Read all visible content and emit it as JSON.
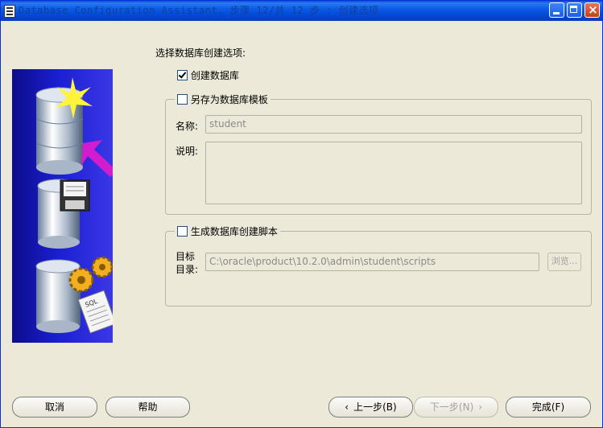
{
  "window": {
    "title": "Database Configuration Assistant, 步骤 12/共 12 步 : 创建选项",
    "colors": {
      "titlebar": "#0a4fd6",
      "client_bg": "#ece9d8",
      "close_btn": "#c73f1c"
    }
  },
  "main": {
    "section_title": "选择数据库创建选项:",
    "create_db": {
      "label": "创建数据库",
      "checked": true
    },
    "save_template": {
      "legend": "另存为数据库模板",
      "checked": false,
      "name_label": "名称:",
      "name_value": "student",
      "desc_label": "说明:",
      "desc_value": ""
    },
    "gen_scripts": {
      "legend": "生成数据库创建脚本",
      "checked": false,
      "dest_label_line1": "目标",
      "dest_label_line2": "目录:",
      "dest_value": "C:\\oracle\\product\\10.2.0\\admin\\student\\scripts",
      "browse_label": "浏览..."
    }
  },
  "footer": {
    "cancel": "取消",
    "help": "帮助",
    "back": "上一步(B)",
    "next": "下一步(N)",
    "finish": "完成(F)"
  },
  "illustration": {
    "icons": [
      "database-new-icon",
      "database-template-icon",
      "database-script-icon"
    ],
    "script_sheet_text": "SQL"
  }
}
